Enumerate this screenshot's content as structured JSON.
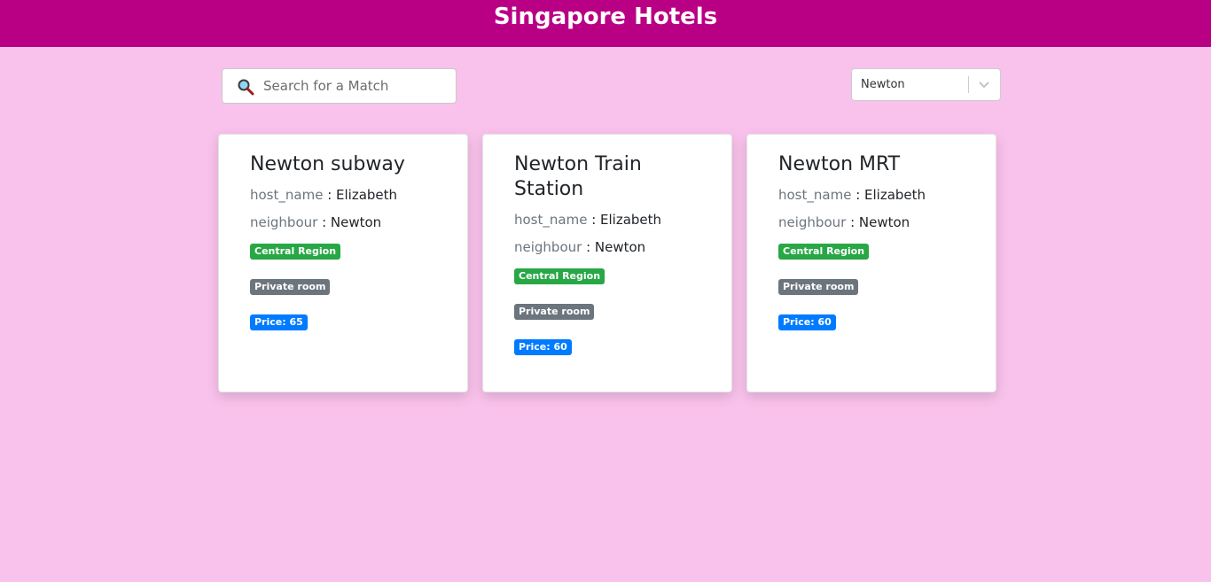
{
  "header": {
    "title": "Singapore Hotels"
  },
  "search": {
    "placeholder": "Search for a Match",
    "value": ""
  },
  "filter": {
    "selected": "Newton"
  },
  "colors": {
    "header_bg": "#b90085",
    "page_bg": "#f9c2ec",
    "region_badge": "#28a745",
    "room_badge": "#6c757d",
    "price_badge": "#007bff"
  },
  "cards": [
    {
      "name": "Newton subway",
      "host_key": "host_name",
      "host_value": "Elizabeth",
      "neighbour_key": "neighbour",
      "neighbour_value": "Newton",
      "region": "Central Region",
      "room_type": "Private room",
      "price": "Price: 65"
    },
    {
      "name": "Newton Train Station",
      "host_key": "host_name",
      "host_value": "Elizabeth",
      "neighbour_key": "neighbour",
      "neighbour_value": "Newton",
      "region": "Central Region",
      "room_type": "Private room",
      "price": "Price: 60"
    },
    {
      "name": "Newton MRT",
      "host_key": "host_name",
      "host_value": "Elizabeth",
      "neighbour_key": "neighbour",
      "neighbour_value": "Newton",
      "region": "Central Region",
      "room_type": "Private room",
      "price": "Price: 60"
    }
  ]
}
